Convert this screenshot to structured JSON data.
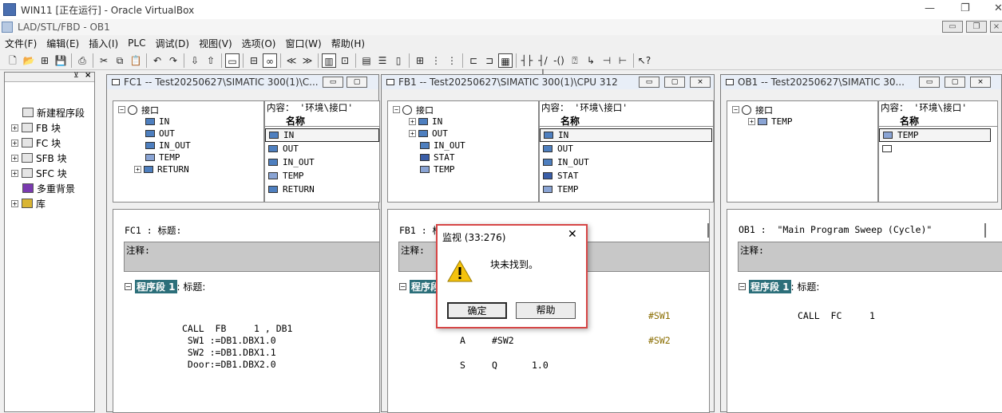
{
  "host": {
    "title": "WIN11 [正在运行] - Oracle VirtualBox",
    "min": "—",
    "restore": "❐",
    "close": "✕"
  },
  "app": {
    "title": "LAD/STL/FBD  - OB1"
  },
  "menu": [
    "文件(F)",
    "编辑(E)",
    "插入(I)",
    "PLC",
    "调试(D)",
    "视图(V)",
    "选项(O)",
    "窗口(W)",
    "帮助(H)"
  ],
  "nav": {
    "items": [
      {
        "label": "新建程序段",
        "icon": "new-network-icon",
        "expand": ""
      },
      {
        "label": "FB 块",
        "icon": "fb-block-icon",
        "expand": "+"
      },
      {
        "label": "FC 块",
        "icon": "fc-block-icon",
        "expand": "+"
      },
      {
        "label": "SFB 块",
        "icon": "sfb-block-icon",
        "expand": "+"
      },
      {
        "label": "SFC 块",
        "icon": "sfc-block-icon",
        "expand": "+"
      },
      {
        "label": "多重背景",
        "icon": "multi-instance-icon",
        "expand": ""
      },
      {
        "label": "库",
        "icon": "library-icon",
        "expand": "+"
      }
    ]
  },
  "fc1": {
    "title": "FC1 -- Test20250627\\SIMATIC 300(1)\\C...",
    "content_header": "内容： '环境\\接口'",
    "tree_root": "接口",
    "tree": [
      "IN",
      "OUT",
      "IN_OUT",
      "TEMP",
      "RETURN"
    ],
    "col_header": "名称",
    "rows": [
      "IN",
      "OUT",
      "IN_OUT",
      "TEMP",
      "RETURN"
    ],
    "block_title": "FC1 : 标题:",
    "comment": "注释:",
    "network": "程序段 1",
    "network_suffix": ": 标题:",
    "code": [
      "CALL  FB     1 , DB1",
      " SW1 :=DB1.DBX1.0",
      " SW2 :=DB1.DBX1.1",
      " Door:=DB1.DBX2.0"
    ]
  },
  "fb1": {
    "title": "FB1 -- Test20250627\\SIMATIC 300(1)\\CPU 312",
    "content_header": "内容： '环境\\接口'",
    "tree_root": "接口",
    "tree": [
      "IN",
      "OUT",
      "IN_OUT",
      "STAT",
      "TEMP"
    ],
    "col_header": "名称",
    "rows": [
      "IN",
      "OUT",
      "IN_OUT",
      "STAT",
      "TEMP"
    ],
    "block_title": "FB1 : 标",
    "comment": "注释:",
    "network": "程序段",
    "code_op1": "A",
    "code_arg1": "#SW2",
    "code_cmt1": "#SW1",
    "code_cmt2": "#SW2",
    "code_op2": "S",
    "code_arg2": "Q",
    "code_val2": "1.0"
  },
  "ob1": {
    "title": "OB1 -- Test20250627\\SIMATIC 30...",
    "content_header": "内容： '环境\\接口'",
    "tree_root": "接口",
    "tree": [
      "TEMP"
    ],
    "col_header": "名称",
    "rows": [
      "TEMP"
    ],
    "block_title": "OB1 :  \"Main Program Sweep (Cycle)\"",
    "comment": "注释:",
    "network": "程序段 1",
    "network_suffix": ": 标题:",
    "code": "CALL  FC     1"
  },
  "dialog": {
    "title": "监视 (33:276)",
    "message": "块未找到。",
    "ok": "确定",
    "help": "帮助",
    "close": "✕",
    "icon": "warning-icon"
  },
  "colors": {
    "selection_bg": "#2c6f7a",
    "comment_bg": "#c8c8c8",
    "dialog_border": "#d64646",
    "symbol_text": "#8a6d00"
  }
}
